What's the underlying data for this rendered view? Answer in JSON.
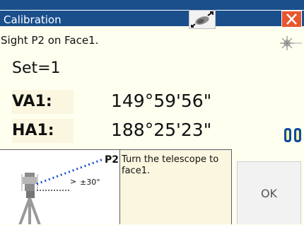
{
  "titlebar": {
    "title": "Calibration",
    "laser_icon": "laser-pointer-icon",
    "close_icon": "close-icon"
  },
  "main": {
    "instruction": "Sight P2 on Face1.",
    "set_label": "Set=1",
    "va_label": "VA1:",
    "va_value": "149°59'56\"",
    "ha_label": "HA1:",
    "ha_value": "188°25'23\"",
    "laser_status_icon": "laser-status-icon",
    "battery_icon": "battery-icon"
  },
  "diagram": {
    "point_label": "P2",
    "angle_label": "±30°",
    "instrument_icon": "instrument-icon"
  },
  "help": {
    "text": "Turn the telescope to face1."
  },
  "buttons": {
    "ok": "OK"
  },
  "colors": {
    "titlebar": "#1a4f8c",
    "close": "#e8562e",
    "background": "#fffff0",
    "panel": "#fbf6e0"
  }
}
